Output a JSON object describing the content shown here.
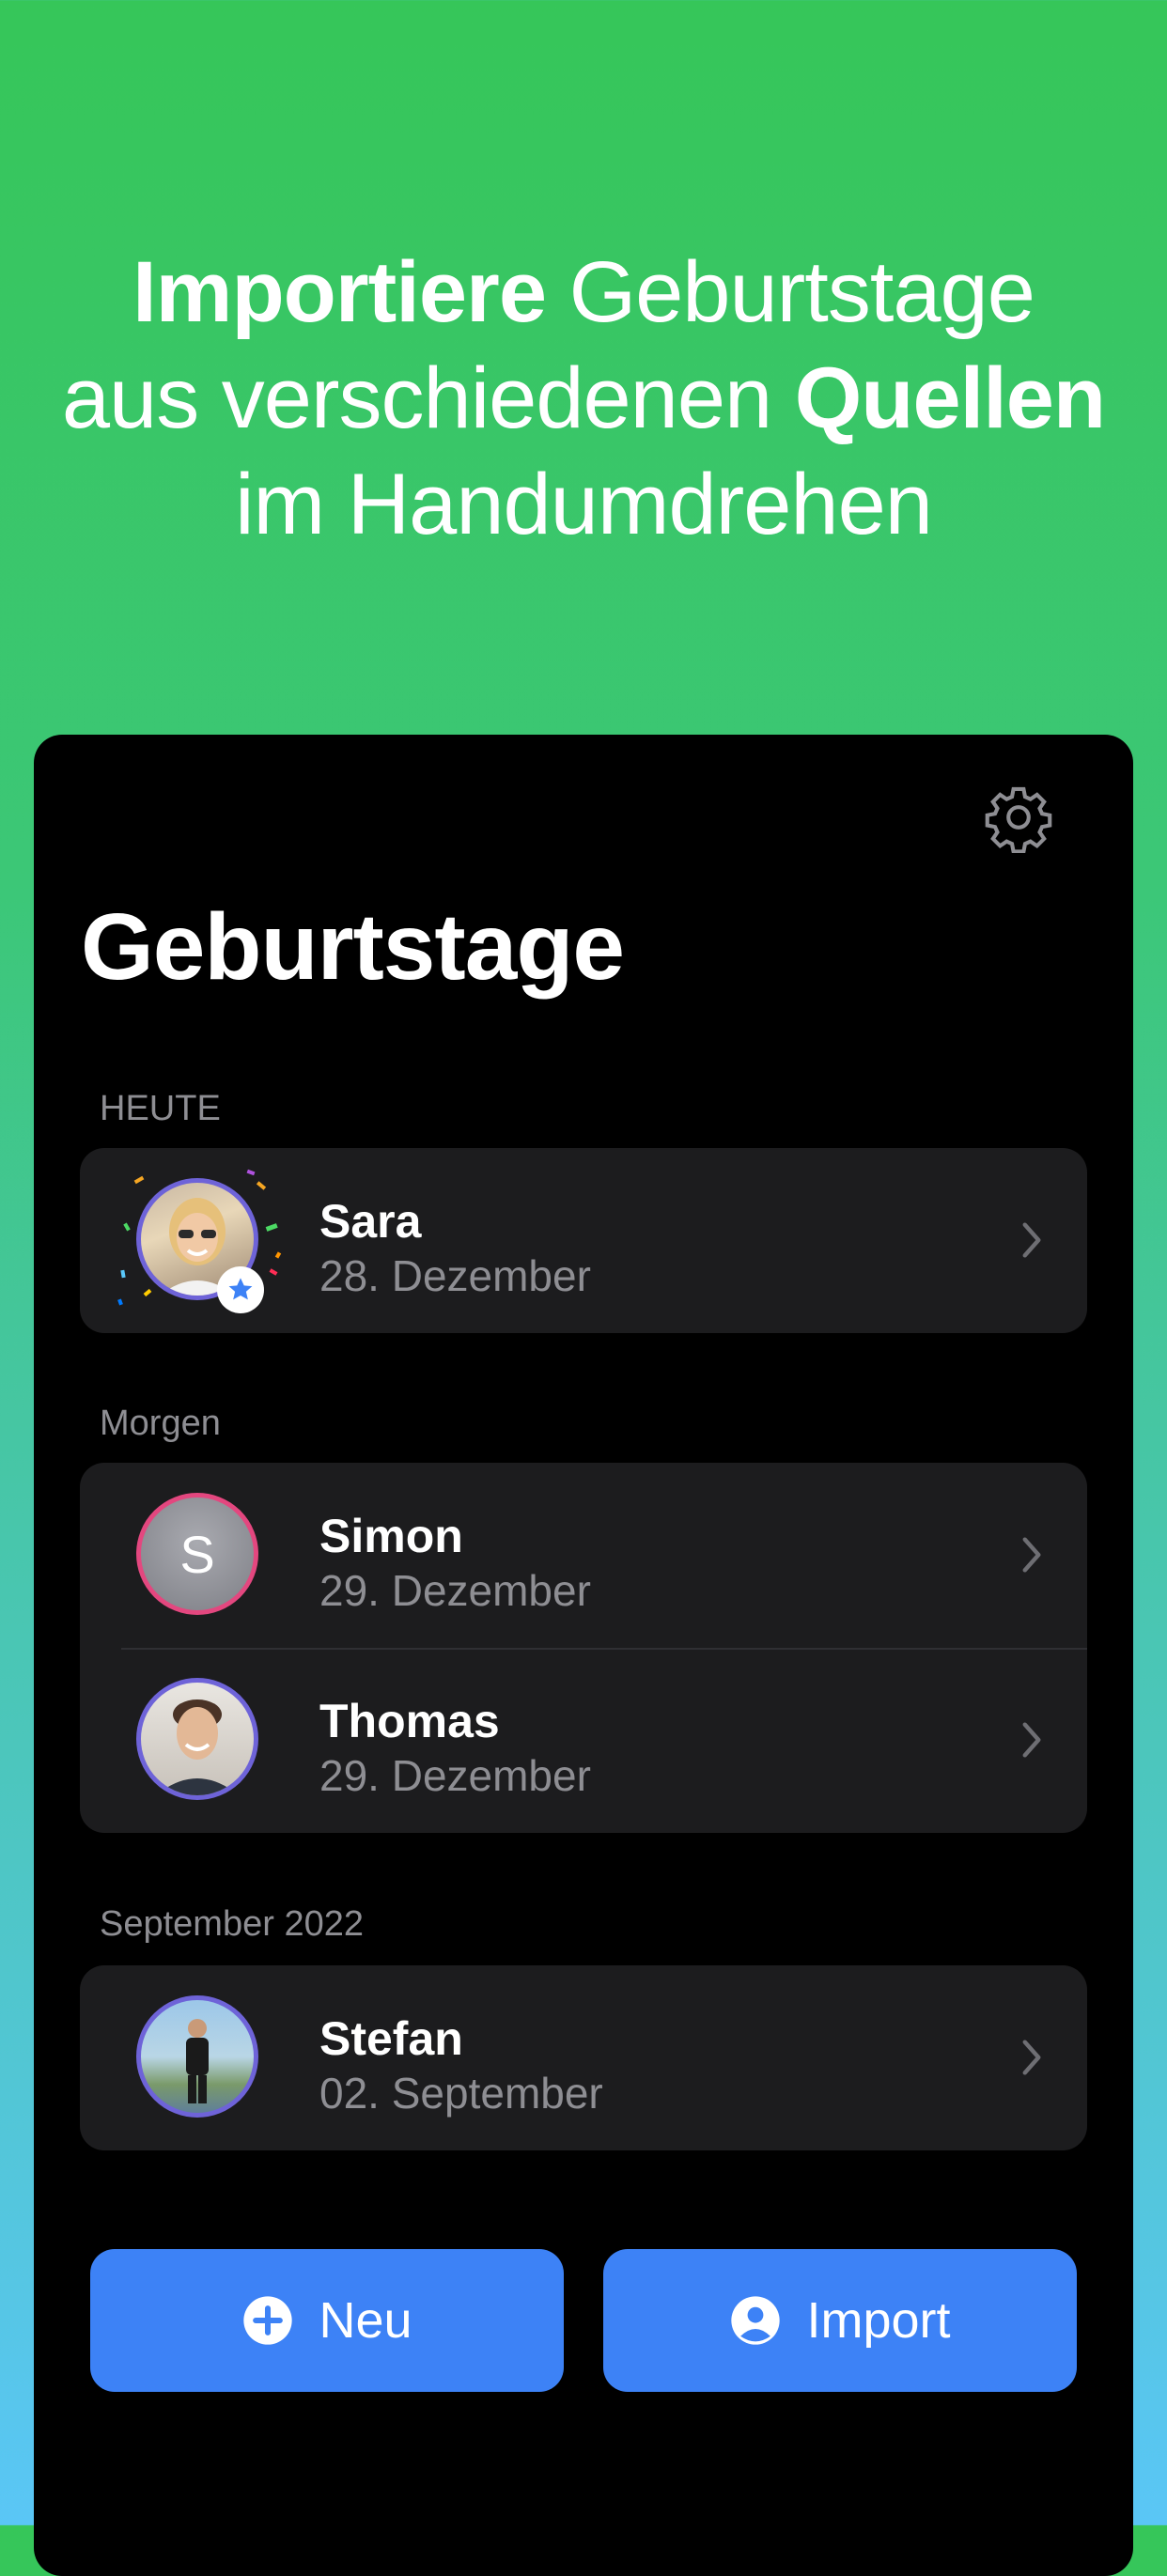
{
  "headline": {
    "line1_bold": "Importiere",
    "line1_rest": "Geburtstage",
    "line2_rest": "aus verschiedenen",
    "line2_bold": "Quellen",
    "line3": "im Handumdrehen"
  },
  "screen": {
    "title": "Geburtstage",
    "settings_icon": "gear-icon"
  },
  "sections": [
    {
      "label": "HEUTE",
      "people": [
        {
          "name": "Sara",
          "date": "28. Dezember",
          "avatar": "photo-woman-sunglasses",
          "favorite": true
        }
      ]
    },
    {
      "label": "Morgen",
      "people": [
        {
          "name": "Simon",
          "date": "29. Dezember",
          "avatar_letter": "S"
        },
        {
          "name": "Thomas",
          "date": "29. Dezember",
          "avatar": "photo-man-smiling"
        }
      ]
    },
    {
      "label": "September 2022",
      "people": [
        {
          "name": "Stefan",
          "date": "02. September",
          "avatar": "photo-man-outdoor"
        }
      ]
    }
  ],
  "buttons": {
    "new_label": "Neu",
    "new_icon": "plus-circle-icon",
    "import_label": "Import",
    "import_icon": "person-circle-icon"
  },
  "colors": {
    "accent_blue": "#3d82f6",
    "gradient_top": "#36c659",
    "gradient_bottom": "#5ac6f6",
    "card_bg": "#1c1c1e"
  }
}
